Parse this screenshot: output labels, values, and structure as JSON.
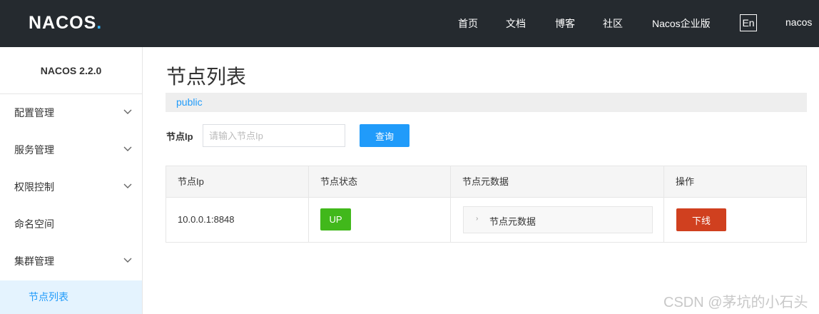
{
  "header": {
    "logo": {
      "text": "NACOS",
      "dot": "."
    },
    "nav": [
      "首页",
      "文档",
      "博客",
      "社区",
      "Nacos企业版"
    ],
    "lang": "En",
    "user": "nacos"
  },
  "sidebar": {
    "version": "NACOS 2.2.0",
    "items": [
      {
        "label": "配置管理",
        "expandable": true
      },
      {
        "label": "服务管理",
        "expandable": true
      },
      {
        "label": "权限控制",
        "expandable": true
      },
      {
        "label": "命名空间",
        "expandable": false
      },
      {
        "label": "集群管理",
        "expandable": true
      }
    ],
    "active_sub": "节点列表"
  },
  "main": {
    "title": "节点列表",
    "namespace": "public",
    "filter": {
      "label": "节点Ip",
      "placeholder": "请输入节点Ip",
      "value": "",
      "query_label": "查询"
    },
    "table": {
      "headers": [
        "节点Ip",
        "节点状态",
        "节点元数据",
        "操作"
      ],
      "rows": [
        {
          "ip": "10.0.0.1:8848",
          "status": "UP",
          "metadata": "节点元数据",
          "action": "下线"
        }
      ]
    }
  },
  "watermark": "CSDN @茅坑的小石头",
  "colors": {
    "header_bg": "#252a2f",
    "primary": "#209bfa",
    "status_up": "#41b81b",
    "danger": "#d0401f"
  }
}
